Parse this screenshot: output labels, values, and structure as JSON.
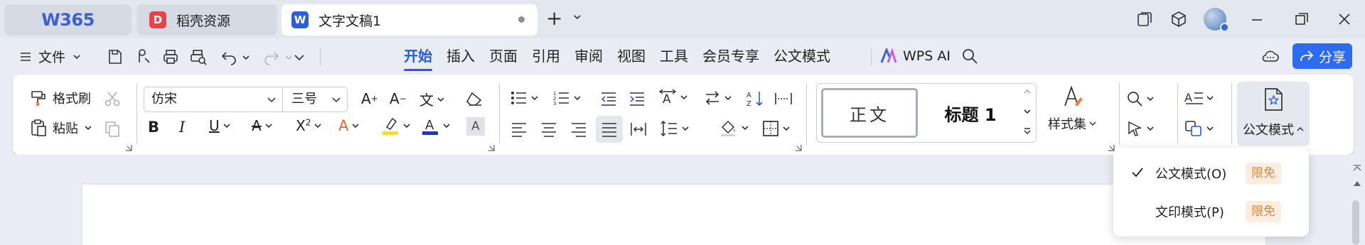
{
  "app": {
    "name": "W365"
  },
  "tabs": [
    {
      "label": "W365",
      "icon": "wps-logo"
    },
    {
      "label": "稻壳资源",
      "icon": "docer-icon",
      "badge_letter": "D"
    },
    {
      "label": "文字文稿1",
      "icon": "writer-icon",
      "badge_letter": "W",
      "active": true,
      "unsaved": true
    }
  ],
  "menu": {
    "file_label": "文件",
    "tabs": [
      "开始",
      "插入",
      "页面",
      "引用",
      "审阅",
      "视图",
      "工具",
      "会员专享",
      "公文模式"
    ],
    "active_tab": "开始",
    "ai_label": "WPS AI",
    "share_label": "分享"
  },
  "ribbon": {
    "format_painter": "格式刷",
    "paste": "粘贴",
    "font_name": "仿宋",
    "font_size": "三号",
    "style_normal": "正文",
    "style_heading1": "标题  1",
    "style_set": "样式集",
    "gongwen_mode": "公文模式"
  },
  "dropdown": {
    "items": [
      {
        "label": "公文模式(O)",
        "checked": true,
        "badge": "限免"
      },
      {
        "label": "文印模式(P)",
        "checked": false,
        "badge": "限免"
      }
    ]
  },
  "colors": {
    "accent": "#2458e6",
    "share_bg": "#2d6cf0",
    "highlight": "#ffe000",
    "font_color": "#1238d8",
    "badge_bg": "#fbeee0",
    "badge_text": "#d88a3c"
  }
}
